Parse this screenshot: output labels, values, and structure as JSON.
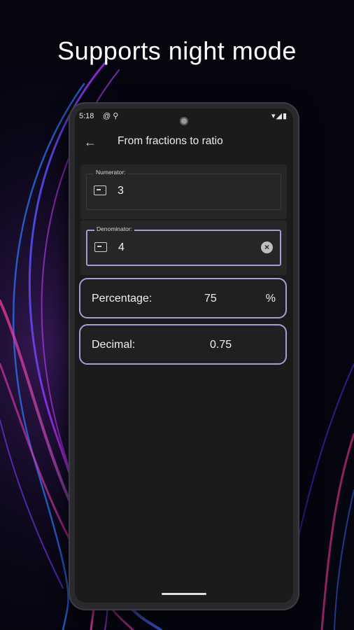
{
  "promo": {
    "headline": "Supports night mode"
  },
  "status_bar": {
    "time": "5:18",
    "left_icons": [
      "at-sign-icon",
      "antenna-icon"
    ],
    "right_icons": [
      "wifi-icon",
      "signal-icon",
      "battery-icon"
    ]
  },
  "app_bar": {
    "title": "From fractions to ratio",
    "back_icon": "arrow-left-icon"
  },
  "numerator": {
    "label": "Numerator:",
    "value": "3"
  },
  "denominator": {
    "label": "Denominator:",
    "value": "4"
  },
  "results": {
    "percentage": {
      "label": "Percentage:",
      "value": "75",
      "unit": "%"
    },
    "decimal": {
      "label": "Decimal:",
      "value": "0.75"
    }
  },
  "colors": {
    "screen_bg": "#1b1b1b",
    "card_bg": "#262626",
    "accent": "#a99cd6",
    "text": "#f0f0f0"
  }
}
